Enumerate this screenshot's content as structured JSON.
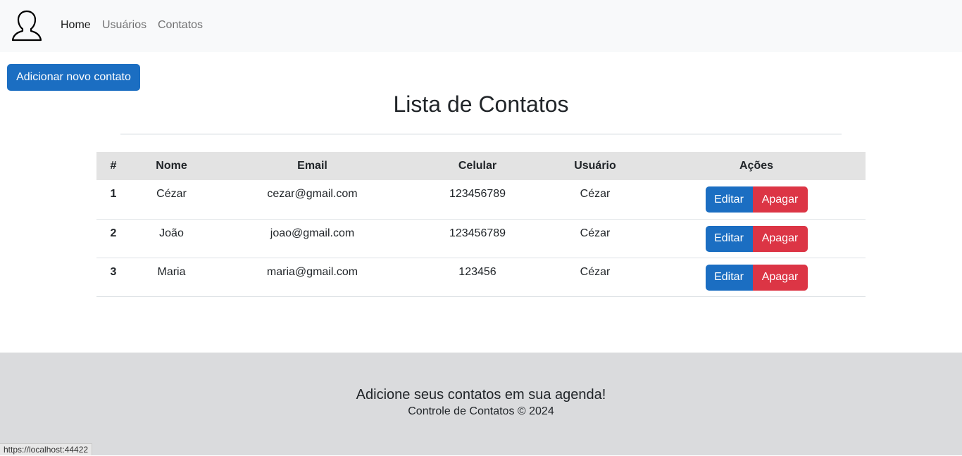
{
  "nav": {
    "logo_icon": "user-outline-icon",
    "items": [
      {
        "label": "Home",
        "active": true
      },
      {
        "label": "Usuários",
        "active": false
      },
      {
        "label": "Contatos",
        "active": false
      }
    ]
  },
  "add_button_label": "Adicionar novo contato",
  "page_title": "Lista de Contatos",
  "table": {
    "headers": [
      "#",
      "Nome",
      "Email",
      "Celular",
      "Usuário",
      "Ações"
    ],
    "rows": [
      {
        "id": "1",
        "nome": "Cézar",
        "email": "cezar@gmail.com",
        "celular": "123456789",
        "usuario": "Cézar"
      },
      {
        "id": "2",
        "nome": "João",
        "email": "joao@gmail.com",
        "celular": "123456789",
        "usuario": "Cézar"
      },
      {
        "id": "3",
        "nome": "Maria",
        "email": "maria@gmail.com",
        "celular": "123456",
        "usuario": "Cézar"
      }
    ],
    "edit_label": "Editar",
    "delete_label": "Apagar"
  },
  "footer": {
    "headline": "Adicione seus contatos em sua agenda!",
    "copyright": "Controle de Contatos © 2024"
  },
  "status_url": "https://localhost:44422",
  "colors": {
    "primary": "#1b6ec2",
    "danger": "#dc3545",
    "navbar_bg": "#f8f9fa",
    "footer_bg": "#dadbdd",
    "table_header_bg": "#e3e3e3"
  }
}
